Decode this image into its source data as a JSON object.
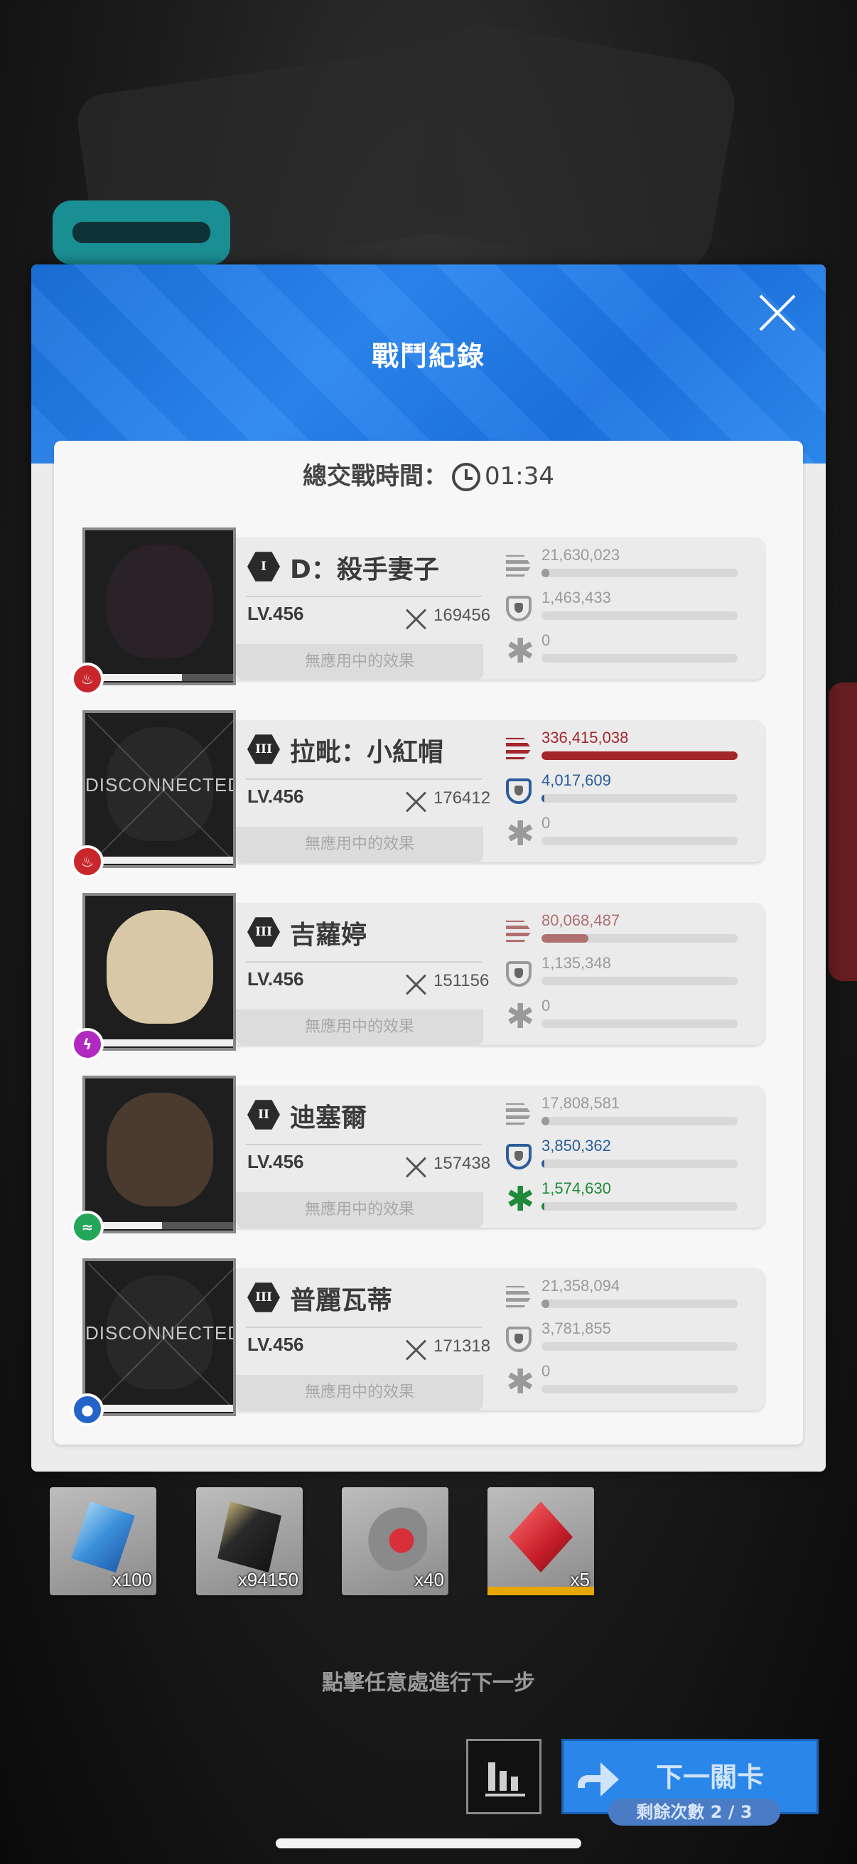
{
  "modal": {
    "title": "戰鬥紀錄"
  },
  "total_time": {
    "label": "總交戰時間：",
    "value": "01:34"
  },
  "characters": [
    {
      "burst": "I",
      "name": "D：殺手妻子",
      "level": "LV.456",
      "attack": "169456",
      "effect": "無應用中的效果",
      "element": "fire",
      "element_color": "#c8262b",
      "disconnected": "",
      "hp_fraction": 0.6,
      "damage": "21,630,023",
      "damage_fraction": 0.04,
      "shield": "1,463,433",
      "shield_fraction": 0,
      "heal": "0",
      "heal_fraction": 0,
      "damage_color": "#9a9a9a",
      "shield_color": "#9a9a9a",
      "heal_color": "#9a9a9a"
    },
    {
      "burst": "III",
      "name": "拉毗：小紅帽",
      "level": "LV.456",
      "attack": "176412",
      "effect": "無應用中的效果",
      "element": "fire",
      "element_color": "#c8262b",
      "disconnected": "DISCONNECTED",
      "hp_fraction": 1,
      "damage": "336,415,038",
      "damage_fraction": 1,
      "shield": "4,017,609",
      "shield_fraction": 0.01,
      "heal": "0",
      "heal_fraction": 0,
      "damage_color": "#a3262b",
      "shield_color": "#2a5d9a",
      "heal_color": "#9a9a9a"
    },
    {
      "burst": "III",
      "name": "吉蘿婷",
      "level": "LV.456",
      "attack": "151156",
      "effect": "無應用中的效果",
      "element": "electric",
      "element_color": "#b02ac0",
      "disconnected": "",
      "hp_fraction": 1,
      "damage": "80,068,487",
      "damage_fraction": 0.24,
      "shield": "1,135,348",
      "shield_fraction": 0,
      "heal": "0",
      "heal_fraction": 0,
      "damage_color": "#b07070",
      "shield_color": "#9a9a9a",
      "heal_color": "#9a9a9a"
    },
    {
      "burst": "II",
      "name": "迪塞爾",
      "level": "LV.456",
      "attack": "157438",
      "effect": "無應用中的效果",
      "element": "wind",
      "element_color": "#23a65a",
      "disconnected": "",
      "hp_fraction": 0.45,
      "damage": "17,808,581",
      "damage_fraction": 0.04,
      "shield": "3,850,362",
      "shield_fraction": 0.01,
      "heal": "1,574,630",
      "heal_fraction": 0.01,
      "damage_color": "#9a9a9a",
      "shield_color": "#2a5d9a",
      "heal_color": "#1f8a3a"
    },
    {
      "burst": "III",
      "name": "普麗瓦蒂",
      "level": "LV.456",
      "attack": "171318",
      "effect": "無應用中的效果",
      "element": "water",
      "element_color": "#2463c8",
      "disconnected": "DISCONNECTED",
      "hp_fraction": 1,
      "damage": "21,358,094",
      "damage_fraction": 0.04,
      "shield": "3,781,855",
      "shield_fraction": 0,
      "heal": "0",
      "heal_fraction": 0,
      "damage_color": "#9a9a9a",
      "shield_color": "#9a9a9a",
      "heal_color": "#9a9a9a"
    }
  ],
  "rewards": [
    {
      "name": "crystal-item-icon",
      "quantity": "x100"
    },
    {
      "name": "credit-card-item-icon",
      "quantity": "x94150"
    },
    {
      "name": "core-dust-item-icon",
      "quantity": "x40"
    },
    {
      "name": "red-module-item-icon",
      "quantity": "x5"
    }
  ],
  "hint": "點擊任意處進行下一步",
  "next_button": {
    "label": "下一關卡"
  },
  "remaining": "剩餘次數 2 / 3"
}
